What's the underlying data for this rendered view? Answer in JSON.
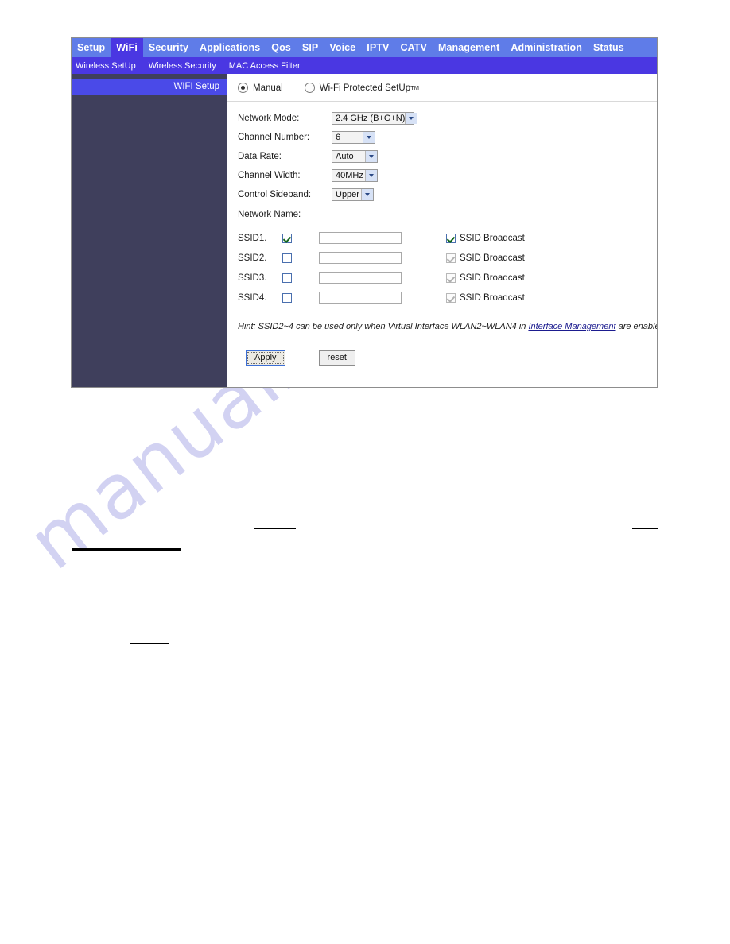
{
  "topnav": {
    "items": [
      {
        "label": "Setup",
        "active": false
      },
      {
        "label": "WiFi",
        "active": true
      },
      {
        "label": "Security",
        "active": false
      },
      {
        "label": "Applications",
        "active": false
      },
      {
        "label": "Qos",
        "active": false
      },
      {
        "label": "SIP",
        "active": false
      },
      {
        "label": "Voice",
        "active": false
      },
      {
        "label": "IPTV",
        "active": false
      },
      {
        "label": "CATV",
        "active": false
      },
      {
        "label": "Management",
        "active": false
      },
      {
        "label": "Administration",
        "active": false
      },
      {
        "label": "Status",
        "active": false
      }
    ]
  },
  "subnav": {
    "items": [
      {
        "label": "Wireless SetUp"
      },
      {
        "label": "Wireless Security"
      },
      {
        "label": "MAC Access Filter"
      }
    ]
  },
  "sidebar": {
    "items": [
      {
        "label": "WIFI Setup",
        "active": true
      }
    ]
  },
  "mode": {
    "manual_label": "Manual",
    "wps_label": "Wi-Fi Protected SetUp",
    "wps_superscript": "TM",
    "selected": "Manual"
  },
  "form": {
    "network_mode": {
      "label": "Network Mode:",
      "value": "2.4 GHz (B+G+N)"
    },
    "channel_number": {
      "label": "Channel Number:",
      "value": "6"
    },
    "data_rate": {
      "label": "Data Rate:",
      "value": "Auto"
    },
    "channel_width": {
      "label": "Channel Width:",
      "value": "40MHz"
    },
    "control_sideband": {
      "label": "Control Sideband:",
      "value": "Upper"
    },
    "network_name_label": "Network Name:"
  },
  "ssid_table": {
    "broadcast_label": "SSID Broadcast",
    "rows": [
      {
        "label": "SSID1.",
        "enabled": true,
        "name": "",
        "broadcast": true,
        "broadcast_disabled": false
      },
      {
        "label": "SSID2.",
        "enabled": false,
        "name": "",
        "broadcast": true,
        "broadcast_disabled": true
      },
      {
        "label": "SSID3.",
        "enabled": false,
        "name": "",
        "broadcast": true,
        "broadcast_disabled": true
      },
      {
        "label": "SSID4.",
        "enabled": false,
        "name": "",
        "broadcast": true,
        "broadcast_disabled": true
      }
    ]
  },
  "hint": {
    "prefix": "Hint: SSID2~4 can be used only when Virtual Interface WLAN2~WLAN4 in ",
    "link": "Interface Management",
    "suffix": " are enabled."
  },
  "buttons": {
    "apply_label": "Apply",
    "reset_label": "reset"
  },
  "watermark": {
    "text": "manualshive.com"
  },
  "colors": {
    "topnav_bg": "#5f7ce8",
    "topnav_active_bg": "#4a37e2",
    "subnav_bg": "#4a37e2",
    "sidebar_bg": "#3f3f5c",
    "sidebar_active_bg": "#4a4ae8",
    "link": "#1b1b8f",
    "watermark": "#d2d2f2"
  }
}
